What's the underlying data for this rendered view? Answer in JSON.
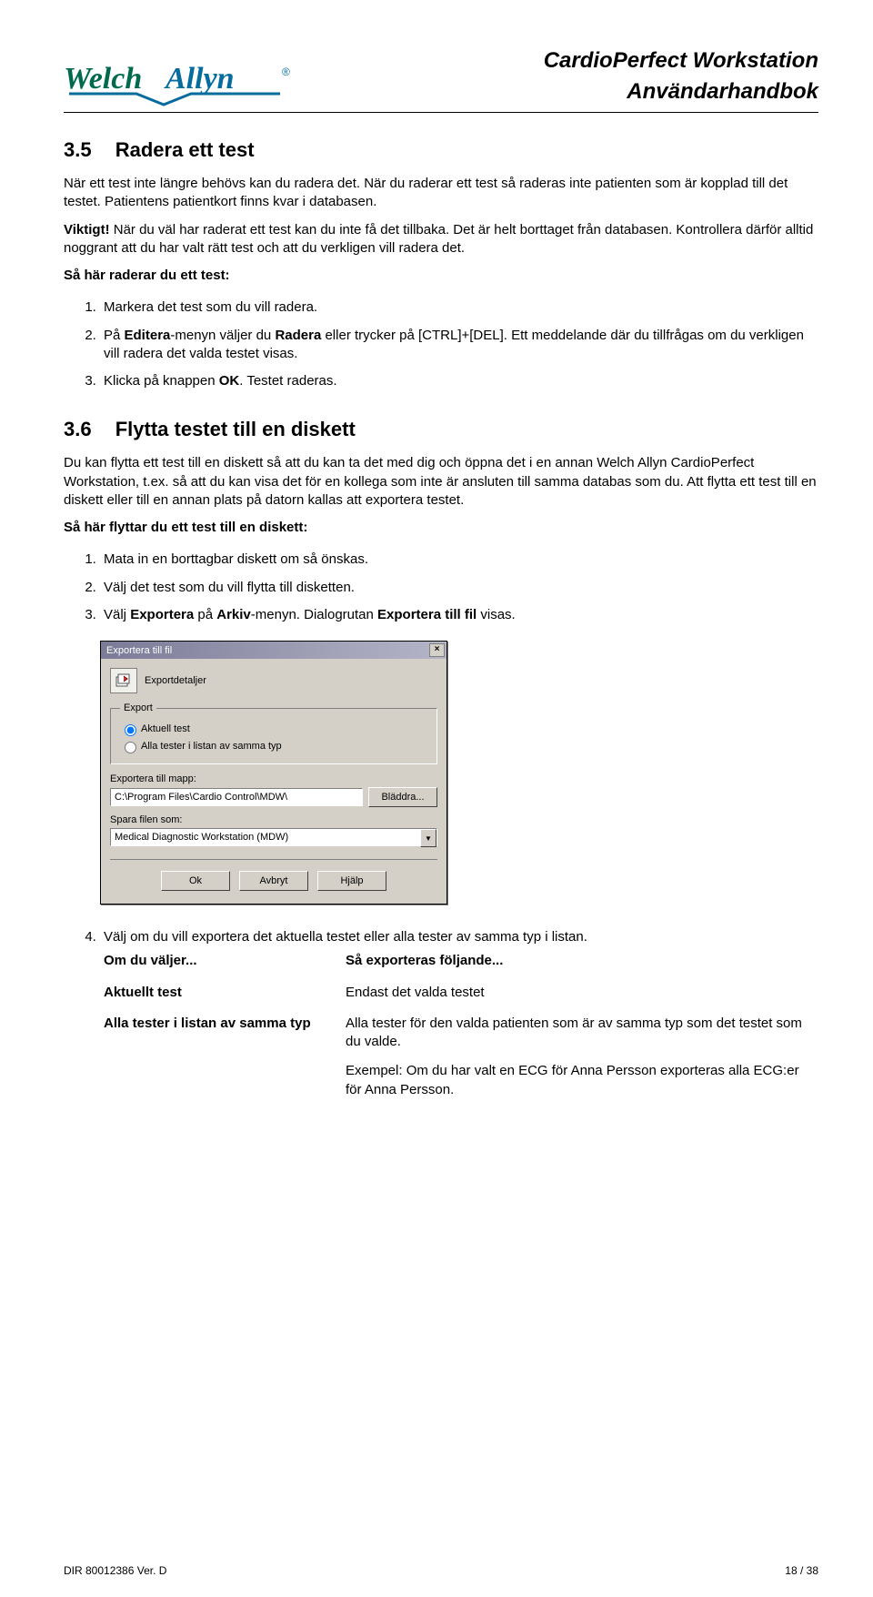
{
  "header": {
    "brand": "WelchAllyn",
    "trademark": "®",
    "title1": "CardioPerfect Workstation",
    "title2": "Användarhandbok"
  },
  "section35": {
    "number": "3.5",
    "title": "Radera ett test",
    "para1": "När ett test inte längre behövs kan du radera det. När du raderar ett test så raderas inte patienten som är kopplad till det testet. Patientens patientkort finns kvar i databasen.",
    "important_lead": "Viktigt!",
    "important_rest": " När du väl har raderat ett test kan du inte få det tillbaka. Det är helt borttaget från databasen. Kontrollera därför alltid noggrant att du har valt rätt test och att du verkligen vill radera det.",
    "howto_title": "Så här raderar du ett test:",
    "steps": {
      "s1": "Markera det test som du vill radera.",
      "s2_a": "På ",
      "s2_b": "Editera",
      "s2_c": "-menyn väljer du ",
      "s2_d": "Radera",
      "s2_e": " eller trycker på [CTRL]+[DEL]. Ett meddelande där du tillfrågas om du verkligen vill radera det valda testet visas.",
      "s3_a": "Klicka på knappen ",
      "s3_b": "OK",
      "s3_c": ". Testet raderas."
    }
  },
  "section36": {
    "number": "3.6",
    "title": "Flytta testet till en diskett",
    "para1": "Du kan flytta ett test till en diskett så att du kan ta det med dig och öppna det i en annan Welch Allyn CardioPerfect Workstation, t.ex. så att du kan visa det för en kollega som inte är ansluten till samma databas som du. Att flytta ett test till en diskett eller till en annan plats på datorn kallas att exportera testet.",
    "howto_title": "Så här flyttar du ett test till en diskett:",
    "steps": {
      "s1": "Mata in en borttagbar diskett om så önskas.",
      "s2": "Välj det test som du vill flytta till disketten.",
      "s3_a": "Välj ",
      "s3_b": "Exportera",
      "s3_c": " på ",
      "s3_d": "Arkiv",
      "s3_e": "-menyn. Dialogrutan ",
      "s3_f": "Exportera till fil",
      "s3_g": " visas."
    },
    "dialog": {
      "title": "Exportera till fil",
      "details_label": "Exportdetaljer",
      "group_legend": "Export",
      "radio1": "Aktuell test",
      "radio2": "Alla tester i listan av samma typ",
      "folder_label": "Exportera till mapp:",
      "folder_value": "C:\\Program Files\\Cardio Control\\MDW\\",
      "browse_btn": "Bläddra...",
      "save_label": "Spara filen som:",
      "format_value": "Medical Diagnostic Workstation (MDW)",
      "ok": "Ok",
      "cancel": "Avbryt",
      "help": "Hjälp"
    },
    "step4": "Välj om du vill exportera det aktuella testet eller alla tester av samma typ i listan.",
    "table": {
      "h1": "Om du väljer...",
      "h2": "Så exporteras följande...",
      "r1c1": "Aktuellt test",
      "r1c2": "Endast det valda testet",
      "r2c1": "Alla tester i listan av samma typ",
      "r2c2": "Alla tester för den valda patienten som är av samma typ som det testet som du valde.",
      "r2ex": "Exempel: Om du har valt en ECG för Anna Persson exporteras alla ECG:er för Anna Persson."
    }
  },
  "footer": {
    "left": "DIR 80012386 Ver. D",
    "right": "18  / 38"
  }
}
